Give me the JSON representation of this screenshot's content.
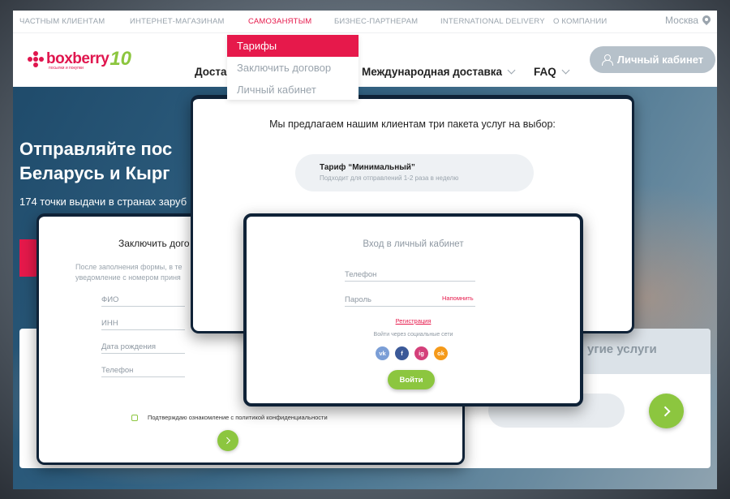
{
  "topbar": {
    "links": [
      "ЧАСТНЫМ КЛИЕНТАМ",
      "ИНТЕРНЕТ-МАГАЗИНАМ",
      "САМОЗАНЯТЫМ",
      "БИЗНЕС-ПАРТНЕРАМ",
      "INTERNATIONAL DELIVERY",
      "О КОМПАНИИ"
    ],
    "active_link": "САМОЗАНЯТЫМ",
    "city": "Москва"
  },
  "header": {
    "logo_text": "boxberry",
    "logo_number": "10",
    "logo_tagline": "посылки и покупки",
    "nav": [
      "Достав",
      "Международная доставка",
      "FAQ"
    ],
    "cabinet_button": "Личный кабинет"
  },
  "dropdown": {
    "items": [
      "Тарифы",
      "Заключить договор",
      "Личный кабинет"
    ],
    "active_item": "Тарифы"
  },
  "hero": {
    "title_line1": "Отправляйте пос",
    "title_line2": "Беларусь и Кырг",
    "subtitle": "174 точки выдачи в странах заруб",
    "other_services": "угие услуги"
  },
  "contract_modal": {
    "title": "Заключить дого",
    "desc_line1": "После заполнения формы, в те",
    "desc_line2": "уведомление с номером приня",
    "fields": [
      "ФИО",
      "ИНН",
      "Дата рождения",
      "Телефон"
    ],
    "consent": "Подтверждаю ознакомление с политикой конфиденциальности"
  },
  "tariffs_modal": {
    "title": "Мы предлагаем нашим клиентам три пакета услуг на выбор:",
    "tariff_name": "Тариф “Минимальный”",
    "tariff_desc": "Подходит для отправлений 1-2 раза в неделю"
  },
  "login_modal": {
    "title": "Вход в личный кабинет",
    "phone_placeholder": "Телефон",
    "password_placeholder": "Пароль",
    "remind_link": "Напомнить",
    "register_link": "Регистрация",
    "social_label": "Войти через социальные сети",
    "socials": [
      "vk",
      "f",
      "ig",
      "ok"
    ],
    "login_button": "Войти"
  },
  "colors": {
    "accent_red": "#e6194b",
    "accent_green": "#8cc63f",
    "muted_grey": "#9aa4ad",
    "modal_border": "#0f2237"
  }
}
